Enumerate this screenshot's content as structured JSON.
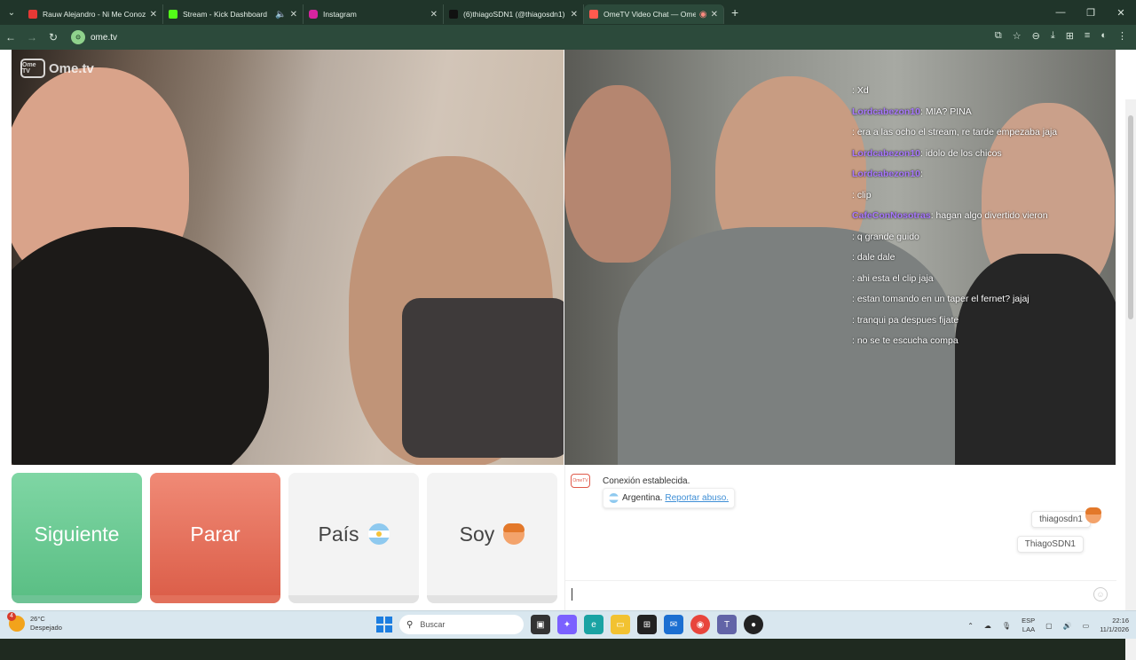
{
  "tabs": [
    {
      "title": "Rauw Alejandro - Ni Me Conoz",
      "color": "#e53935",
      "active": false
    },
    {
      "title": "Stream - Kick Dashboard",
      "color": "#53fc18",
      "active": false
    },
    {
      "title": "Instagram",
      "color": "#d6249f",
      "active": false
    },
    {
      "title": "(6)thiagoSDN1 (@thiagosdn1)",
      "color": "#111111",
      "active": false
    },
    {
      "title": "OmeTV Video Chat — Ome",
      "color": "#ff5a4e",
      "active": true
    }
  ],
  "address": {
    "url": "ome.tv"
  },
  "logo": {
    "text": "Ome.tv",
    "box": "Ome TV"
  },
  "chat_overlay": [
    {
      "user": "",
      "text": ": Xd"
    },
    {
      "user": "Lordcabezon10",
      "text": ": MIA? PINA"
    },
    {
      "user": "",
      "text": ": era a las ocho el stream, re tarde empezaba jaja"
    },
    {
      "user": "Lordcabezon10",
      "text": ": idolo de los chicos"
    },
    {
      "user": "Lordcabezon10",
      "text": ":"
    },
    {
      "user": "",
      "text": ""
    },
    {
      "user": "",
      "text": ""
    },
    {
      "user": "",
      "text": ": clip"
    },
    {
      "user": "CafeConNosotras",
      "text": ": hagan algo divertido vieron"
    },
    {
      "user": "",
      "text": ": q grande guido"
    },
    {
      "user": "",
      "text": ": dale dale"
    },
    {
      "user": "",
      "text": ": ahi esta el clip jaja"
    },
    {
      "user": "",
      "text": ": estan tomando en un taper el fernet? jajaj"
    },
    {
      "user": "",
      "text": ": tranqui pa despues fijate"
    },
    {
      "user": "",
      "text": ": no se te escucha compa"
    }
  ],
  "buttons": {
    "next": "Siguiente",
    "stop": "Parar",
    "country": "País",
    "me": "Soy"
  },
  "system_message": {
    "line1": "Conexión establecida.",
    "country": "Argentina.",
    "report": "Reportar abuso."
  },
  "my_messages": [
    "thiagosdn1",
    "ThiagoSDN1"
  ],
  "taskbar": {
    "temp": "26°C",
    "weather": "Despejado",
    "badge": "4",
    "search": "Buscar",
    "lang1": "ESP",
    "lang2": "LAA",
    "time": "22:16",
    "date": "11/1/2026"
  }
}
